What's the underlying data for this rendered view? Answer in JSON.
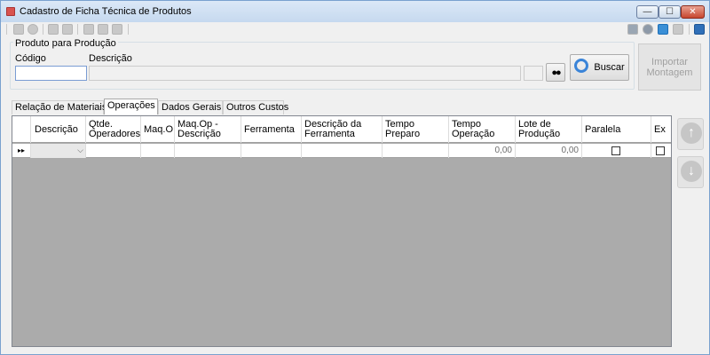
{
  "window": {
    "title": "Cadastro de Ficha Técnica de Produtos"
  },
  "producao": {
    "group_label": "Produto para Produção",
    "codigo_label": "Código",
    "descricao_label": "Descrição",
    "codigo_value": "",
    "descricao_value": "",
    "buscar_label": "Buscar",
    "importar_line1": "Importar",
    "importar_line2": "Montagem"
  },
  "tabs": [
    {
      "label": "Relação de Materiais"
    },
    {
      "label": "Operações",
      "active": true
    },
    {
      "label": "Dados Gerais"
    },
    {
      "label": "Outros Custos"
    }
  ],
  "grid": {
    "columns": [
      "Descrição",
      "Qtde. Operadores",
      "Maq.O",
      "Maq.Op - Descrição",
      "Ferramenta",
      "Descrição da Ferramenta",
      "Tempo Preparo",
      "Tempo Operação",
      "Lote de Produção",
      "Paralela",
      "Ex"
    ],
    "row": {
      "indicator": "▸▸",
      "tempo_operacao": "0,00",
      "lote_producao": "0,00"
    }
  }
}
